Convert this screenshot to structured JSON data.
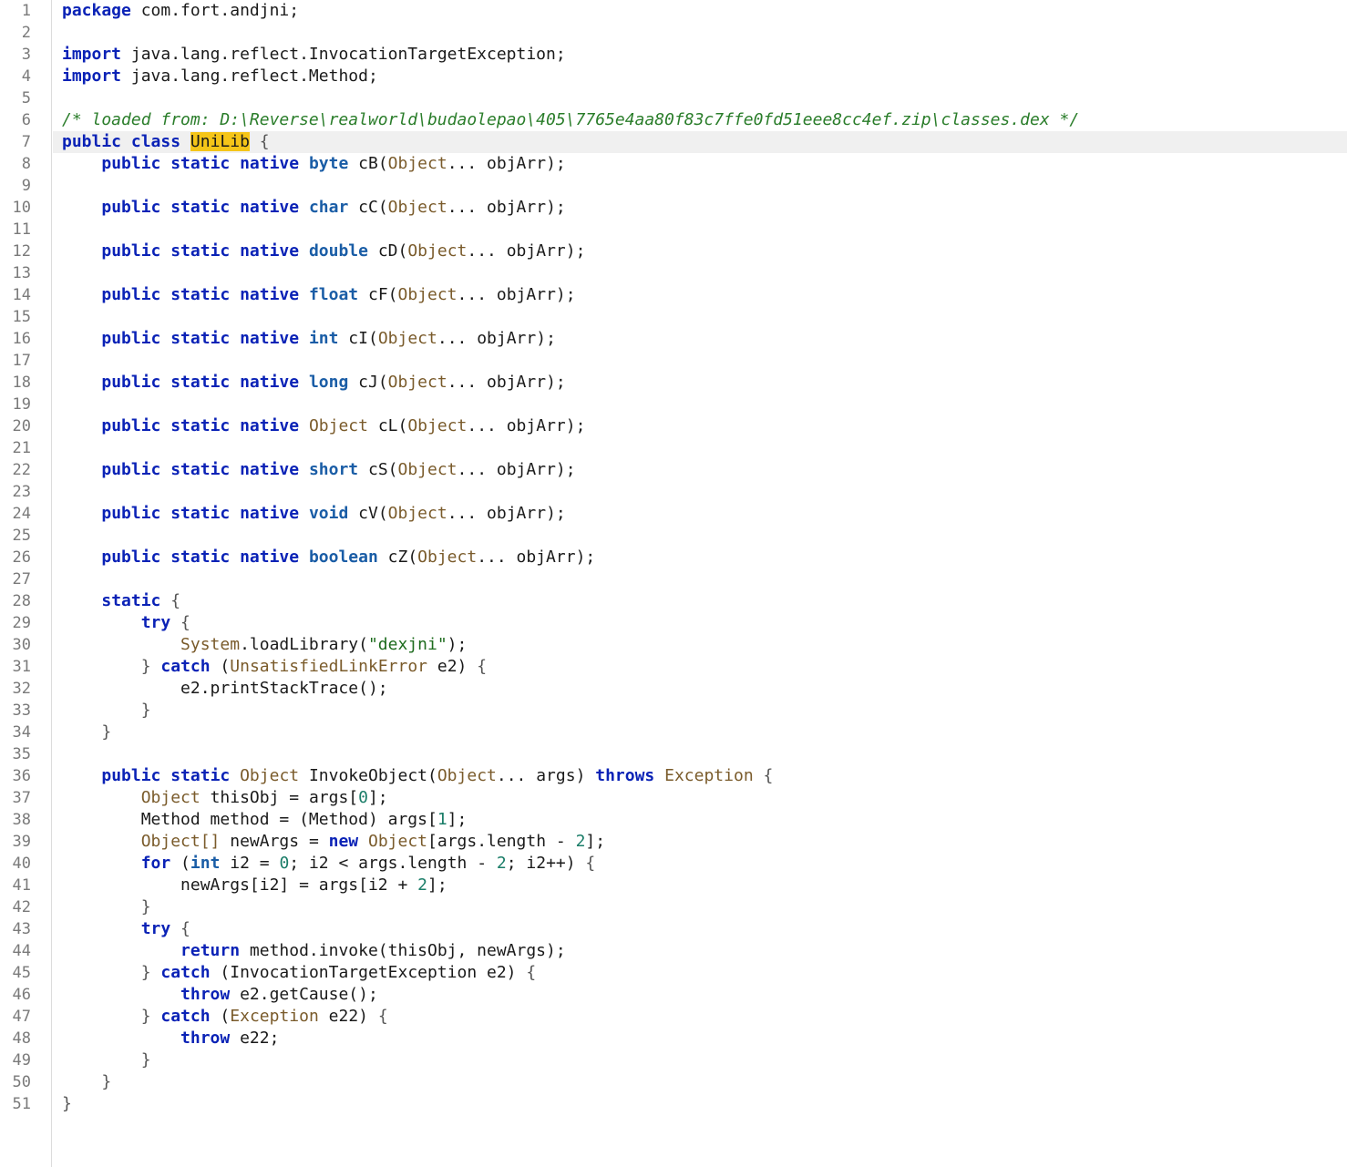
{
  "editor": {
    "language": "java",
    "current_line": 7,
    "search_highlight": "UniLib",
    "colors": {
      "keyword": "#0a22b6",
      "type": "#1a5da6",
      "class_name": "#7a5b2b",
      "string": "#1d6b1d",
      "number": "#1a7d68",
      "comment": "#2a7d2a",
      "highlight": "#f5c518",
      "line_number": "#7a7a7a"
    },
    "lines": [
      [
        {
          "t": "package",
          "c": "kw"
        },
        {
          "t": " com.fort.andjni;"
        }
      ],
      [],
      [
        {
          "t": "import",
          "c": "kw"
        },
        {
          "t": " java.lang.reflect.InvocationTargetException;"
        }
      ],
      [
        {
          "t": "import",
          "c": "kw"
        },
        {
          "t": " java.lang.reflect.Method;"
        }
      ],
      [],
      [
        {
          "t": "/* loaded from: D:\\Reverse\\realworld\\budaolepao\\405\\7765e4aa80f83c7ffe0fd51eee8cc4ef.zip\\classes.dex */",
          "c": "cmt"
        }
      ],
      [
        {
          "t": "public class",
          "c": "kw"
        },
        {
          "t": " "
        },
        {
          "t": "",
          "c": "caret"
        },
        {
          "t": "UniLib",
          "c": "hl"
        },
        {
          "t": " {",
          "c": "op"
        }
      ],
      [
        {
          "t": "    "
        },
        {
          "t": "public static native",
          "c": "kw"
        },
        {
          "t": " "
        },
        {
          "t": "byte",
          "c": "ty"
        },
        {
          "t": " cB("
        },
        {
          "t": "Object",
          "c": "cls"
        },
        {
          "t": "... objArr);"
        }
      ],
      [],
      [
        {
          "t": "    "
        },
        {
          "t": "public static native",
          "c": "kw"
        },
        {
          "t": " "
        },
        {
          "t": "char",
          "c": "ty"
        },
        {
          "t": " cC("
        },
        {
          "t": "Object",
          "c": "cls"
        },
        {
          "t": "... objArr);"
        }
      ],
      [],
      [
        {
          "t": "    "
        },
        {
          "t": "public static native",
          "c": "kw"
        },
        {
          "t": " "
        },
        {
          "t": "double",
          "c": "ty"
        },
        {
          "t": " cD("
        },
        {
          "t": "Object",
          "c": "cls"
        },
        {
          "t": "... objArr);"
        }
      ],
      [],
      [
        {
          "t": "    "
        },
        {
          "t": "public static native",
          "c": "kw"
        },
        {
          "t": " "
        },
        {
          "t": "float",
          "c": "ty"
        },
        {
          "t": " cF("
        },
        {
          "t": "Object",
          "c": "cls"
        },
        {
          "t": "... objArr);"
        }
      ],
      [],
      [
        {
          "t": "    "
        },
        {
          "t": "public static native",
          "c": "kw"
        },
        {
          "t": " "
        },
        {
          "t": "int",
          "c": "ty"
        },
        {
          "t": " cI("
        },
        {
          "t": "Object",
          "c": "cls"
        },
        {
          "t": "... objArr);"
        }
      ],
      [],
      [
        {
          "t": "    "
        },
        {
          "t": "public static native",
          "c": "kw"
        },
        {
          "t": " "
        },
        {
          "t": "long",
          "c": "ty"
        },
        {
          "t": " cJ("
        },
        {
          "t": "Object",
          "c": "cls"
        },
        {
          "t": "... objArr);"
        }
      ],
      [],
      [
        {
          "t": "    "
        },
        {
          "t": "public static native",
          "c": "kw"
        },
        {
          "t": " "
        },
        {
          "t": "Object",
          "c": "cls"
        },
        {
          "t": " cL("
        },
        {
          "t": "Object",
          "c": "cls"
        },
        {
          "t": "... objArr);"
        }
      ],
      [],
      [
        {
          "t": "    "
        },
        {
          "t": "public static native",
          "c": "kw"
        },
        {
          "t": " "
        },
        {
          "t": "short",
          "c": "ty"
        },
        {
          "t": " cS("
        },
        {
          "t": "Object",
          "c": "cls"
        },
        {
          "t": "... objArr);"
        }
      ],
      [],
      [
        {
          "t": "    "
        },
        {
          "t": "public static native",
          "c": "kw"
        },
        {
          "t": " "
        },
        {
          "t": "void",
          "c": "ty"
        },
        {
          "t": " cV("
        },
        {
          "t": "Object",
          "c": "cls"
        },
        {
          "t": "... objArr);"
        }
      ],
      [],
      [
        {
          "t": "    "
        },
        {
          "t": "public static native",
          "c": "kw"
        },
        {
          "t": " "
        },
        {
          "t": "boolean",
          "c": "ty"
        },
        {
          "t": " cZ("
        },
        {
          "t": "Object",
          "c": "cls"
        },
        {
          "t": "... objArr);"
        }
      ],
      [],
      [
        {
          "t": "    "
        },
        {
          "t": "static",
          "c": "kw"
        },
        {
          "t": " {",
          "c": "op"
        }
      ],
      [
        {
          "t": "        "
        },
        {
          "t": "try",
          "c": "kw"
        },
        {
          "t": " {",
          "c": "op"
        }
      ],
      [
        {
          "t": "            "
        },
        {
          "t": "System",
          "c": "cls"
        },
        {
          "t": ".loadLibrary("
        },
        {
          "t": "\"dexjni\"",
          "c": "str"
        },
        {
          "t": ");"
        }
      ],
      [
        {
          "t": "        "
        },
        {
          "t": "}",
          "c": "op"
        },
        {
          "t": " "
        },
        {
          "t": "catch",
          "c": "kw"
        },
        {
          "t": " ("
        },
        {
          "t": "UnsatisfiedLinkError",
          "c": "cls"
        },
        {
          "t": " e2) "
        },
        {
          "t": "{",
          "c": "op"
        }
      ],
      [
        {
          "t": "            e2.printStackTrace();"
        }
      ],
      [
        {
          "t": "        "
        },
        {
          "t": "}",
          "c": "op"
        }
      ],
      [
        {
          "t": "    "
        },
        {
          "t": "}",
          "c": "op"
        }
      ],
      [],
      [
        {
          "t": "    "
        },
        {
          "t": "public static",
          "c": "kw"
        },
        {
          "t": " "
        },
        {
          "t": "Object",
          "c": "cls"
        },
        {
          "t": " InvokeObject("
        },
        {
          "t": "Object",
          "c": "cls"
        },
        {
          "t": "... args) "
        },
        {
          "t": "throws",
          "c": "kw"
        },
        {
          "t": " "
        },
        {
          "t": "Exception",
          "c": "cls"
        },
        {
          "t": " {",
          "c": "op"
        }
      ],
      [
        {
          "t": "        "
        },
        {
          "t": "Object",
          "c": "cls"
        },
        {
          "t": " thisObj = args["
        },
        {
          "t": "0",
          "c": "num"
        },
        {
          "t": "];"
        }
      ],
      [
        {
          "t": "        Method method = (Method) args["
        },
        {
          "t": "1",
          "c": "num"
        },
        {
          "t": "];"
        }
      ],
      [
        {
          "t": "        "
        },
        {
          "t": "Object[]",
          "c": "cls"
        },
        {
          "t": " newArgs = "
        },
        {
          "t": "new",
          "c": "kw"
        },
        {
          "t": " "
        },
        {
          "t": "Object",
          "c": "cls"
        },
        {
          "t": "[args.length - "
        },
        {
          "t": "2",
          "c": "num"
        },
        {
          "t": "];"
        }
      ],
      [
        {
          "t": "        "
        },
        {
          "t": "for",
          "c": "kw"
        },
        {
          "t": " ("
        },
        {
          "t": "int",
          "c": "ty"
        },
        {
          "t": " i2 = "
        },
        {
          "t": "0",
          "c": "num"
        },
        {
          "t": "; i2 < args.length - "
        },
        {
          "t": "2",
          "c": "num"
        },
        {
          "t": "; i2++) "
        },
        {
          "t": "{",
          "c": "op"
        }
      ],
      [
        {
          "t": "            newArgs[i2] = args[i2 + "
        },
        {
          "t": "2",
          "c": "num"
        },
        {
          "t": "];"
        }
      ],
      [
        {
          "t": "        "
        },
        {
          "t": "}",
          "c": "op"
        }
      ],
      [
        {
          "t": "        "
        },
        {
          "t": "try",
          "c": "kw"
        },
        {
          "t": " {",
          "c": "op"
        }
      ],
      [
        {
          "t": "            "
        },
        {
          "t": "return",
          "c": "kw"
        },
        {
          "t": " method.invoke(thisObj, newArgs);"
        }
      ],
      [
        {
          "t": "        "
        },
        {
          "t": "}",
          "c": "op"
        },
        {
          "t": " "
        },
        {
          "t": "catch",
          "c": "kw"
        },
        {
          "t": " (InvocationTargetException e2) "
        },
        {
          "t": "{",
          "c": "op"
        }
      ],
      [
        {
          "t": "            "
        },
        {
          "t": "throw",
          "c": "kw"
        },
        {
          "t": " e2.getCause();"
        }
      ],
      [
        {
          "t": "        "
        },
        {
          "t": "}",
          "c": "op"
        },
        {
          "t": " "
        },
        {
          "t": "catch",
          "c": "kw"
        },
        {
          "t": " ("
        },
        {
          "t": "Exception",
          "c": "cls"
        },
        {
          "t": " e22) "
        },
        {
          "t": "{",
          "c": "op"
        }
      ],
      [
        {
          "t": "            "
        },
        {
          "t": "throw",
          "c": "kw"
        },
        {
          "t": " e22;"
        }
      ],
      [
        {
          "t": "        "
        },
        {
          "t": "}",
          "c": "op"
        }
      ],
      [
        {
          "t": "    "
        },
        {
          "t": "}",
          "c": "op"
        }
      ],
      [
        {
          "t": "}",
          "c": "op"
        }
      ]
    ]
  }
}
